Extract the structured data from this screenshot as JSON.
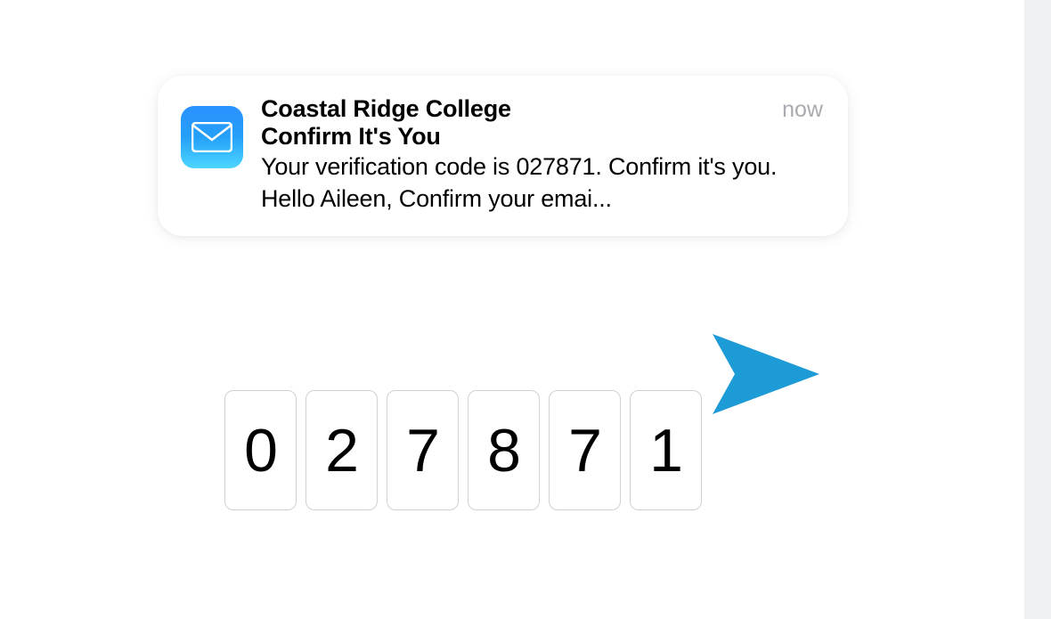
{
  "notification": {
    "sender": "Coastal Ridge College",
    "subject": "Confirm It's You",
    "body": "Your verification code is 027871. Confirm it's you. Hello Aileen, Confirm your emai...",
    "time": "now"
  },
  "code": {
    "d0": "0",
    "d1": "2",
    "d2": "7",
    "d3": "8",
    "d4": "7",
    "d5": "1"
  }
}
